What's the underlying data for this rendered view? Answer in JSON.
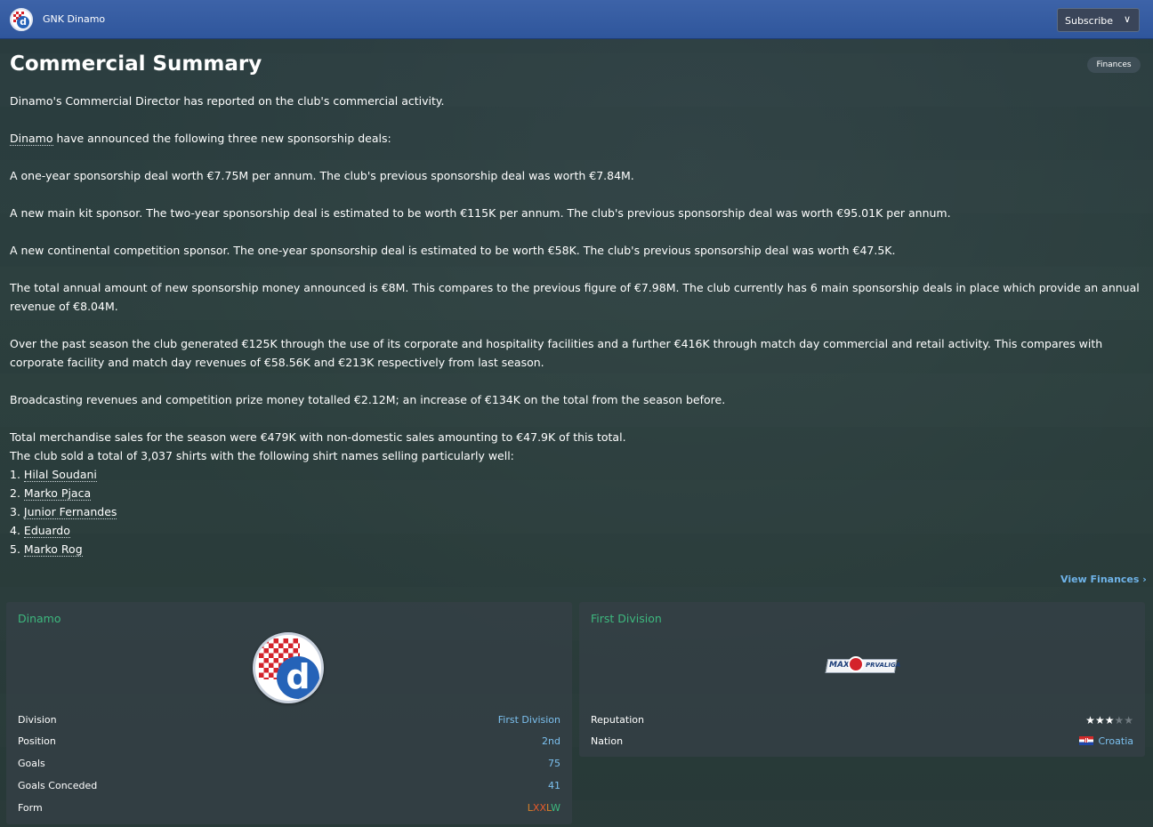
{
  "header": {
    "club_name": "GNK Dinamo",
    "subscribe_label": "Subscribe"
  },
  "page": {
    "title": "Commercial Summary",
    "finances_tag": "Finances",
    "view_finances_link": "View Finances"
  },
  "report": {
    "intro": "Dinamo's Commercial Director has reported on the club's commercial activity.",
    "announce_club": "Dinamo",
    "announce_rest": " have announced the following three new sponsorship deals:",
    "deal1": "A one-year sponsorship deal worth €7.75M per annum. The club's previous sponsorship deal was worth €7.84M.",
    "deal2": "A new main kit sponsor. The two-year sponsorship deal is estimated to be worth €115K per annum. The club's previous sponsorship deal was worth €95.01K per annum.",
    "deal3": "A new continental competition sponsor. The one-year sponsorship deal is estimated to be worth €58K. The club's previous sponsorship deal was worth €47.5K.",
    "total_sponsorship": "The total annual amount of new sponsorship money announced is €8M. This compares to the previous figure of €7.98M. The club currently has 6 main sponsorship deals in place which provide an annual revenue of €8.04M.",
    "facilities": "Over the past season the club generated €125K through the use of its corporate and hospitality facilities and a further €416K through match day commercial and retail activity. This compares with corporate facility and match day revenues of €58.56K and €213K respectively from last season.",
    "broadcasting": "Broadcasting revenues and competition prize money totalled €2.12M; an increase of €134K on the total from the season before.",
    "merchandise": "Total merchandise sales for the season were €479K with non-domestic sales amounting to €47.9K of this total.",
    "shirts_intro": "The club sold a total of 3,037 shirts with the following shirt names selling particularly well:",
    "top_shirts": [
      {
        "rank": "1.",
        "name": "Hilal Soudani"
      },
      {
        "rank": "2.",
        "name": "Marko Pjaca"
      },
      {
        "rank": "3.",
        "name": "Junior Fernandes"
      },
      {
        "rank": "4.",
        "name": "Eduardo"
      },
      {
        "rank": "5.",
        "name": "Marko Rog"
      }
    ]
  },
  "club_panel": {
    "title": "Dinamo",
    "badge_letter": "d",
    "rows": {
      "division_label": "Division",
      "division_value": "First Division",
      "position_label": "Position",
      "position_value": "2nd",
      "goals_label": "Goals",
      "goals_value": "75",
      "conceded_label": "Goals Conceded",
      "conceded_value": "41",
      "form_label": "Form"
    },
    "form": [
      {
        "r": "L",
        "color": "#d9822b"
      },
      {
        "r": "X",
        "color": "#e85a2a"
      },
      {
        "r": "X",
        "color": "#e85a2a"
      },
      {
        "r": "L",
        "color": "#d9822b"
      },
      {
        "r": "W",
        "color": "#3db87e"
      }
    ]
  },
  "league_panel": {
    "title": "First Division",
    "logo_left": "MAX",
    "logo_right": "PRVALIGA",
    "reputation_label": "Reputation",
    "reputation_stars": 3,
    "reputation_max": 5,
    "nation_label": "Nation",
    "nation_value": "Croatia"
  },
  "colors": {
    "accent_green": "#3db87e",
    "link_blue": "#7cc0ef",
    "topbar_blue": "#3d63a8",
    "star_gold": "#f4c20d"
  }
}
